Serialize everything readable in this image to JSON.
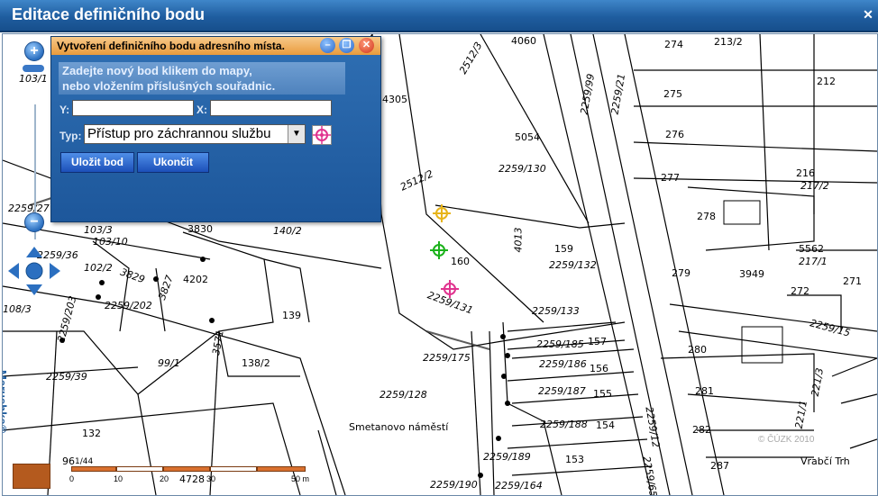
{
  "window": {
    "title": "Editace definičního bodu",
    "close_glyph": "✕"
  },
  "dialog": {
    "title": "Vytvoření definičního bodu adresního místa.",
    "hint_line1": "Zadejte nový bod klikem do mapy,",
    "hint_line2": "nebo vložením příslušných souřadnic.",
    "y_label": "Y:",
    "x_label": "X:",
    "y_value": "",
    "x_value": "",
    "type_label": "Typ:",
    "type_selected": "Přístup pro záchrannou službu",
    "save_label": "Uložit bod",
    "finish_label": "Ukončit"
  },
  "map": {
    "parcels": [
      "4060",
      "274",
      "213/2",
      "212",
      "275",
      "4305",
      "2259/21",
      "2259/99",
      "2512/3",
      "5054",
      "276",
      "2259/130",
      "277",
      "216",
      "217/2",
      "2512/2",
      "3830",
      "140/2",
      "278",
      "4013",
      "159",
      "5562",
      "217/1",
      "103/10",
      "103/3",
      "2259/132",
      "160",
      "279",
      "3949",
      "271",
      "102/2",
      "3829",
      "3827",
      "4202",
      "272",
      "2259/131",
      "2259/133",
      "2259/202",
      "2259/203",
      "139",
      "3571",
      "138/2",
      "2259/15",
      "2259/185",
      "157",
      "280",
      "2259/175",
      "2259/186",
      "156",
      "99/1",
      "2259/39",
      "2259/128",
      "2259/187",
      "155",
      "281",
      "221/3",
      "2259/188",
      "154",
      "282",
      "221/1",
      "2259/12",
      "Smetanovo náměstí",
      "132",
      "2259/189",
      "153",
      "287",
      "Vrabčí Trh",
      "2259/190",
      "2259/164",
      "2259/65",
      "4728",
      "96",
      "103/1",
      "108/3",
      "2259/27",
      "2259/36",
      "1/44"
    ],
    "copyright": "© ČÚZK 2010",
    "brand": "Marushka®",
    "scale_labels": [
      "0",
      "10",
      "20",
      "30",
      "50 m"
    ]
  },
  "colors": {
    "header": "#1f5d9f",
    "dialog_header": "#e99b3c",
    "button": "#1c4fb8"
  },
  "icons": [
    "zoom-in-icon",
    "zoom-out-icon",
    "pan-icon",
    "crosshair-target-icon",
    "minimize-icon",
    "restore-icon",
    "close-icon"
  ]
}
